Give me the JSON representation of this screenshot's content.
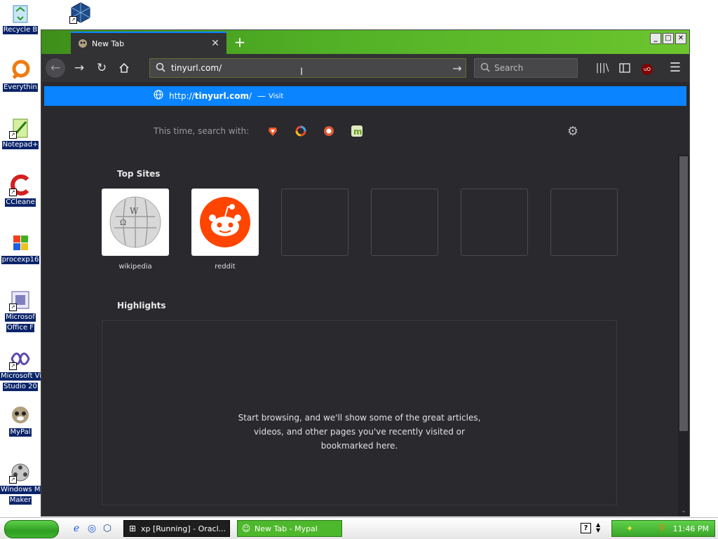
{
  "desktop": {
    "icons": [
      {
        "label": "Recycle B",
        "icon": "recycle-bin-icon"
      },
      {
        "label": "",
        "icon": "virtualbox-icon"
      },
      {
        "label": "Everythin",
        "icon": "everything-search-icon"
      },
      {
        "label": "Notepad+",
        "icon": "notepad-plus-icon"
      },
      {
        "label": "CCleane",
        "icon": "ccleaner-icon"
      },
      {
        "label": "procexp16",
        "icon": "process-explorer-icon"
      },
      {
        "label": "Microsof",
        "label2": "Office F",
        "icon": "office-icon"
      },
      {
        "label": "Microsoft Vi",
        "label2": "Studio 20",
        "icon": "visual-studio-icon"
      },
      {
        "label": "MyPal",
        "icon": "mypal-icon"
      },
      {
        "label": "Windows M",
        "label2": "Maker",
        "icon": "movie-maker-icon"
      }
    ]
  },
  "browser": {
    "tab": {
      "title": "New Tab",
      "close": "✕"
    },
    "new_tab": "+",
    "window_buttons": {
      "minimize": "_",
      "maximize": "□",
      "close": "✕"
    },
    "url": {
      "value": "tinyurl.com/"
    },
    "search": {
      "placeholder": "Search"
    },
    "ublock_label": "uO",
    "suggestion": {
      "url_prefix": "http://",
      "url_host": "tinyurl.com",
      "url_suffix": "/",
      "dash": "—",
      "action": "Visit"
    },
    "one_off": {
      "label": "This time, search with:"
    },
    "top_sites": {
      "title": "Top Sites",
      "sites": [
        {
          "name": "wikipedia"
        },
        {
          "name": "reddit"
        },
        {
          "name": ""
        },
        {
          "name": ""
        },
        {
          "name": ""
        },
        {
          "name": ""
        }
      ]
    },
    "highlights": {
      "title": "Highlights",
      "line1": "Start browsing, and we'll show some of the great articles,",
      "line2": "videos, and other pages you've recently visited or",
      "line3": "bookmarked here."
    }
  },
  "taskbar": {
    "tasks": [
      {
        "label": "xp [Running] - Oracl..."
      },
      {
        "label": "New Tab - Mypal"
      }
    ],
    "help": "?",
    "clock": "11:46 PM"
  },
  "colors": {
    "accent": "#0a84ff",
    "xp_green": "#4db82b",
    "content_bg": "#2a2a2e"
  }
}
